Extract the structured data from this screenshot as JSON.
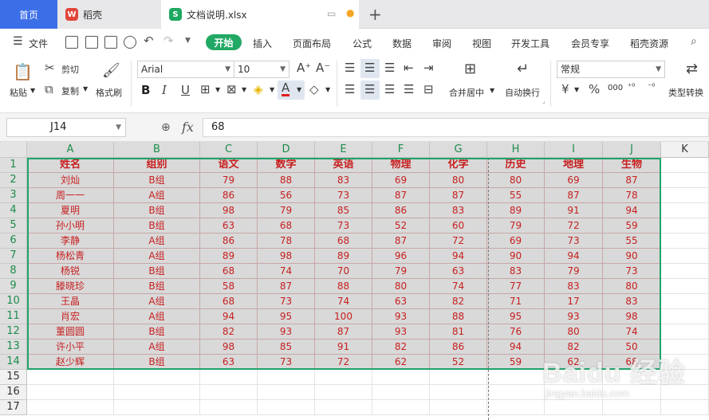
{
  "tabs": {
    "home": "首页",
    "app_tab": "稻壳",
    "doc_tab": "文档说明.xlsx"
  },
  "menu": {
    "file": "文件",
    "items": [
      "开始",
      "插入",
      "页面布局",
      "公式",
      "数据",
      "审阅",
      "视图",
      "开发工具",
      "会员专享",
      "稻壳资源"
    ],
    "active_index": 0
  },
  "ribbon": {
    "paste": "粘贴",
    "cut": "剪切",
    "copy": "复制",
    "format_painter": "格式刷",
    "font_name": "Arial",
    "font_size": "10",
    "merge_center": "合并居中",
    "wrap_text": "自动换行",
    "number_format": "常规",
    "type_convert": "类型转换",
    "currency_symbol": "¥",
    "percent_symbol": "%",
    "thousands_symbol": "000"
  },
  "formula_bar": {
    "name_box": "J14",
    "fx_label": "fx",
    "formula": "68"
  },
  "sheet": {
    "columns": [
      "A",
      "B",
      "C",
      "D",
      "E",
      "F",
      "G",
      "H",
      "I",
      "J",
      "K"
    ],
    "row_numbers": [
      "1",
      "2",
      "3",
      "4",
      "5",
      "6",
      "7",
      "8",
      "9",
      "10",
      "11",
      "12",
      "13",
      "14",
      "15",
      "16",
      "17"
    ],
    "header_row": [
      "姓名",
      "组别",
      "语文",
      "数学",
      "英语",
      "物理",
      "化学",
      "历史",
      "地理",
      "生物"
    ],
    "rows": [
      [
        "刘灿",
        "B组",
        "79",
        "88",
        "83",
        "69",
        "80",
        "80",
        "69",
        "87"
      ],
      [
        "周一一",
        "A组",
        "86",
        "56",
        "73",
        "87",
        "87",
        "55",
        "87",
        "78"
      ],
      [
        "夏明",
        "B组",
        "98",
        "79",
        "85",
        "86",
        "83",
        "89",
        "91",
        "94"
      ],
      [
        "孙小明",
        "B组",
        "63",
        "68",
        "73",
        "52",
        "60",
        "79",
        "72",
        "59"
      ],
      [
        "李静",
        "A组",
        "86",
        "78",
        "68",
        "87",
        "72",
        "69",
        "73",
        "55"
      ],
      [
        "杨松青",
        "A组",
        "89",
        "98",
        "89",
        "96",
        "94",
        "90",
        "94",
        "90"
      ],
      [
        "杨锐",
        "B组",
        "68",
        "74",
        "70",
        "79",
        "63",
        "83",
        "79",
        "73"
      ],
      [
        "滕晓珍",
        "B组",
        "58",
        "87",
        "88",
        "80",
        "74",
        "77",
        "83",
        "80"
      ],
      [
        "王晶",
        "A组",
        "68",
        "73",
        "74",
        "63",
        "82",
        "71",
        "17",
        "83"
      ],
      [
        "肖宏",
        "A组",
        "94",
        "95",
        "100",
        "93",
        "88",
        "95",
        "93",
        "98"
      ],
      [
        "董圆圆",
        "B组",
        "82",
        "93",
        "87",
        "93",
        "81",
        "76",
        "80",
        "74"
      ],
      [
        "许小平",
        "A组",
        "98",
        "85",
        "91",
        "82",
        "86",
        "94",
        "82",
        "50"
      ],
      [
        "赵少辉",
        "B组",
        "63",
        "73",
        "72",
        "62",
        "52",
        "59",
        "62",
        "68"
      ]
    ]
  },
  "watermark": {
    "text": "Baidu 经验",
    "sub": "jingyan.baidu.com"
  },
  "colors": {
    "home_tab": "#3c6ee8",
    "active_menu": "#22a865",
    "cell_text": "#c71f1f",
    "selection_border": "#1fa36a",
    "header_text": "#1c8c4c"
  }
}
